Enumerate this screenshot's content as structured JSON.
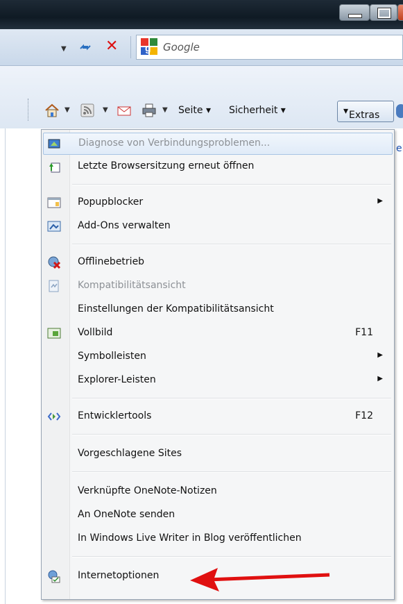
{
  "address": {
    "search_placeholder": "Google"
  },
  "commandbar": {
    "page_label": "Seite",
    "safety_label": "Sicherheit",
    "tools_label": "Extras"
  },
  "menu": {
    "items": [
      {
        "label": "Diagnose von Verbindungsproblemen...",
        "icon": "network-diagnose-icon",
        "disabled": true
      },
      {
        "label": "Letzte Browsersitzung erneut öffnen",
        "icon": "reopen-session-icon"
      },
      {
        "label": "Popupblocker",
        "icon": "popup-blocker-icon",
        "submenu": true
      },
      {
        "label": "Add-Ons verwalten",
        "icon": "addons-icon"
      },
      {
        "label": "Offlinebetrieb",
        "icon": "offline-icon"
      },
      {
        "label": "Kompatibilitätsansicht",
        "icon": "compat-view-icon",
        "disabled": true
      },
      {
        "label": "Einstellungen der Kompatibilitätsansicht"
      },
      {
        "label": "Vollbild",
        "icon": "fullscreen-icon",
        "shortcut": "F11"
      },
      {
        "label": "Symbolleisten",
        "submenu": true
      },
      {
        "label": "Explorer-Leisten",
        "submenu": true
      },
      {
        "label": "Entwicklertools",
        "icon": "devtools-icon",
        "shortcut": "F12"
      },
      {
        "label": "Vorgeschlagene Sites"
      },
      {
        "label": "Verknüpfte OneNote-Notizen"
      },
      {
        "label": "An OneNote senden"
      },
      {
        "label": "In Windows Live Writer in Blog veröffentlichen"
      },
      {
        "label": "Internetoptionen",
        "icon": "internet-options-icon"
      }
    ]
  },
  "colors": {
    "highlight_border": "#a8c4e4",
    "annotation_arrow": "#e01010",
    "disabled_text": "#8d9196"
  }
}
